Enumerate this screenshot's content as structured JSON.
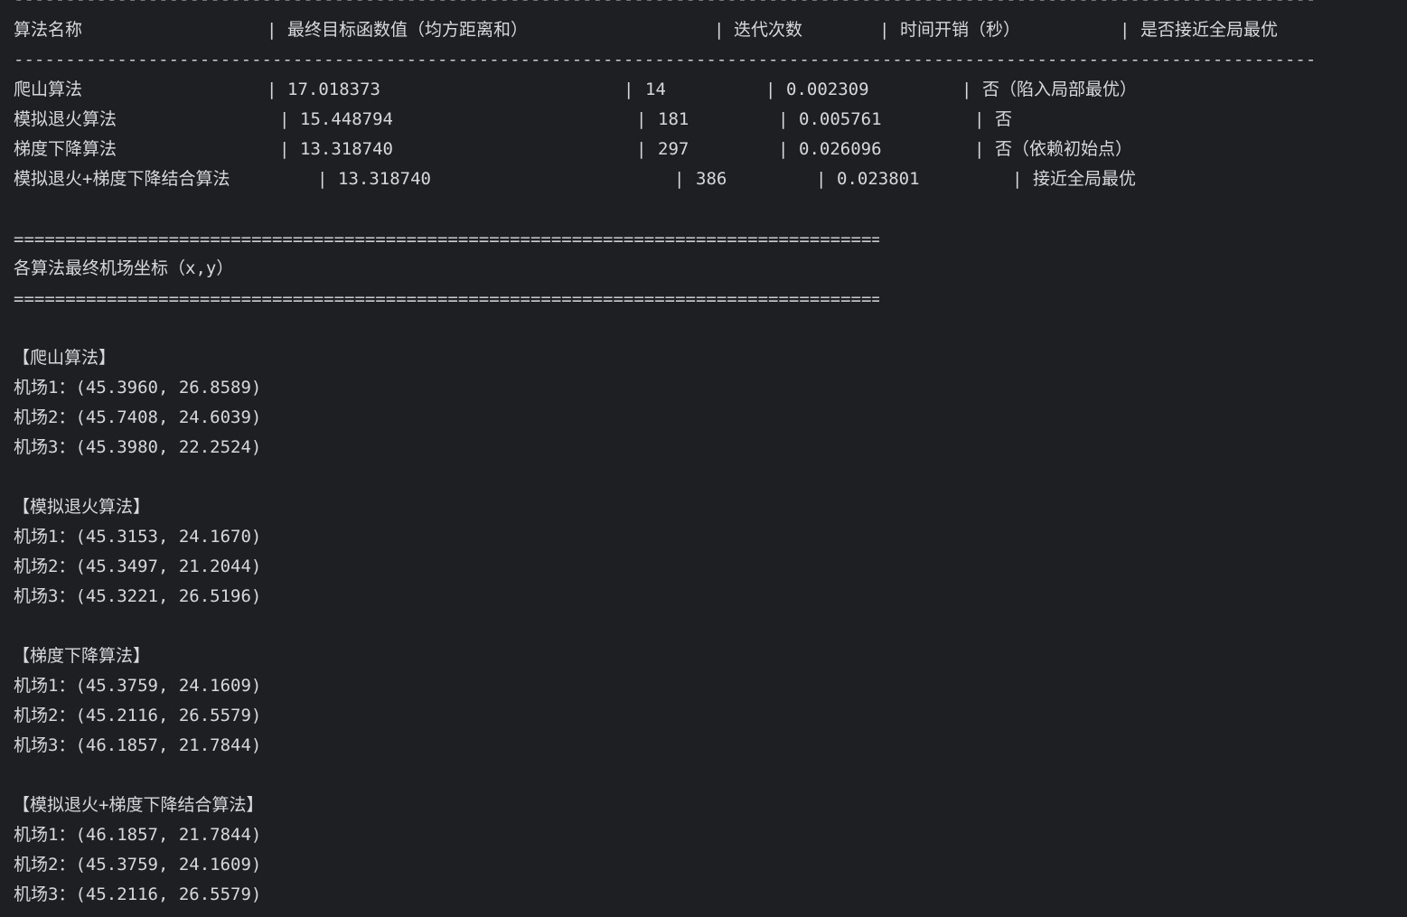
{
  "console": {
    "dash_rule": "------------------------------------------------------------------------------------------------------------------------------------------------------------------------------------------------------------------------------------",
    "eq_rule": "==================================================================================================================",
    "table": {
      "sep": "|",
      "headers": [
        "算法名称",
        "最终目标函数值（均方距离和）",
        "迭代次数",
        "时间开销（秒）",
        "是否接近全局最优"
      ],
      "rows": [
        {
          "name": "爬山算法",
          "value": "17.018373",
          "iters": "14",
          "time": "0.002309",
          "optimal": "否（陷入局部最优）"
        },
        {
          "name": "模拟退火算法",
          "value": "15.448794",
          "iters": "181",
          "time": "0.005761",
          "optimal": "否"
        },
        {
          "name": "梯度下降算法",
          "value": "13.318740",
          "iters": "297",
          "time": "0.026096",
          "optimal": "否（依赖初始点）"
        },
        {
          "name": "模拟退火+梯度下降结合算法",
          "value": "13.318740",
          "iters": "386",
          "time": "0.023801",
          "optimal": "接近全局最优"
        }
      ]
    },
    "coords_title": "各算法最终机场坐标（x,y）",
    "sections": [
      {
        "title": "【爬山算法】",
        "lines": [
          "机场1：(45.3960, 26.8589)",
          "机场2：(45.7408, 24.6039)",
          "机场3：(45.3980, 22.2524)"
        ]
      },
      {
        "title": "【模拟退火算法】",
        "lines": [
          "机场1：(45.3153, 24.1670)",
          "机场2：(45.3497, 21.2044)",
          "机场3：(45.3221, 26.5196)"
        ]
      },
      {
        "title": "【梯度下降算法】",
        "lines": [
          "机场1：(45.3759, 24.1609)",
          "机场2：(45.2116, 26.5579)",
          "机场3：(46.1857, 21.7844)"
        ]
      },
      {
        "title": "【模拟退火+梯度下降结合算法】",
        "lines": [
          "机场1：(46.1857, 21.7844)",
          "机场2：(45.3759, 24.1609)",
          "机场3：(45.2116, 26.5579)"
        ]
      }
    ],
    "colors": {
      "background": "#1e1f22",
      "text": "#d6d8dc"
    }
  }
}
